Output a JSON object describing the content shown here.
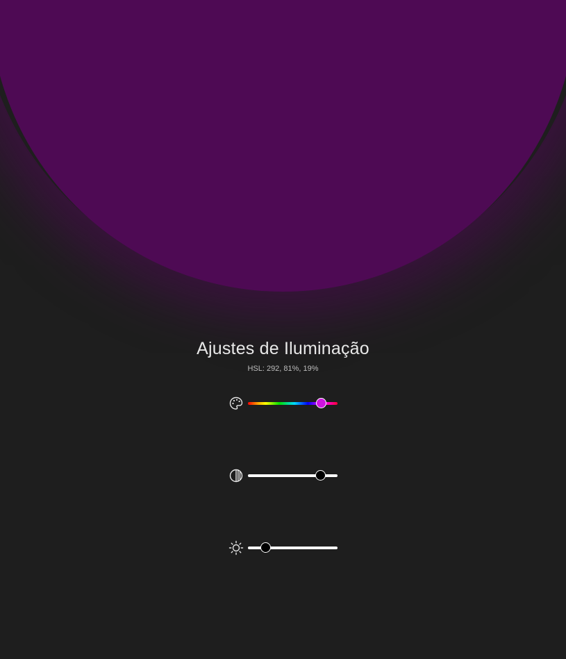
{
  "lighting": {
    "title": "Ajustes de Iluminação",
    "hsl_readout": "HSL: 292, 81%, 19%",
    "hue": 292,
    "saturation": 81,
    "lightness": 19,
    "orb_color": "#4e0a54",
    "glow_color": "#4e0a54",
    "background_color": "#1e1e1e"
  },
  "controls": [
    {
      "id": "hue",
      "icon": "palette-icon",
      "value": 292,
      "max": 360,
      "thumb_color": "#ce14e0"
    },
    {
      "id": "saturation",
      "icon": "contrast-icon",
      "value": 81,
      "max": 100,
      "thumb_color": "#000000"
    },
    {
      "id": "lightness",
      "icon": "sun-icon",
      "value": 19,
      "max": 100,
      "thumb_color": "#000000"
    }
  ]
}
